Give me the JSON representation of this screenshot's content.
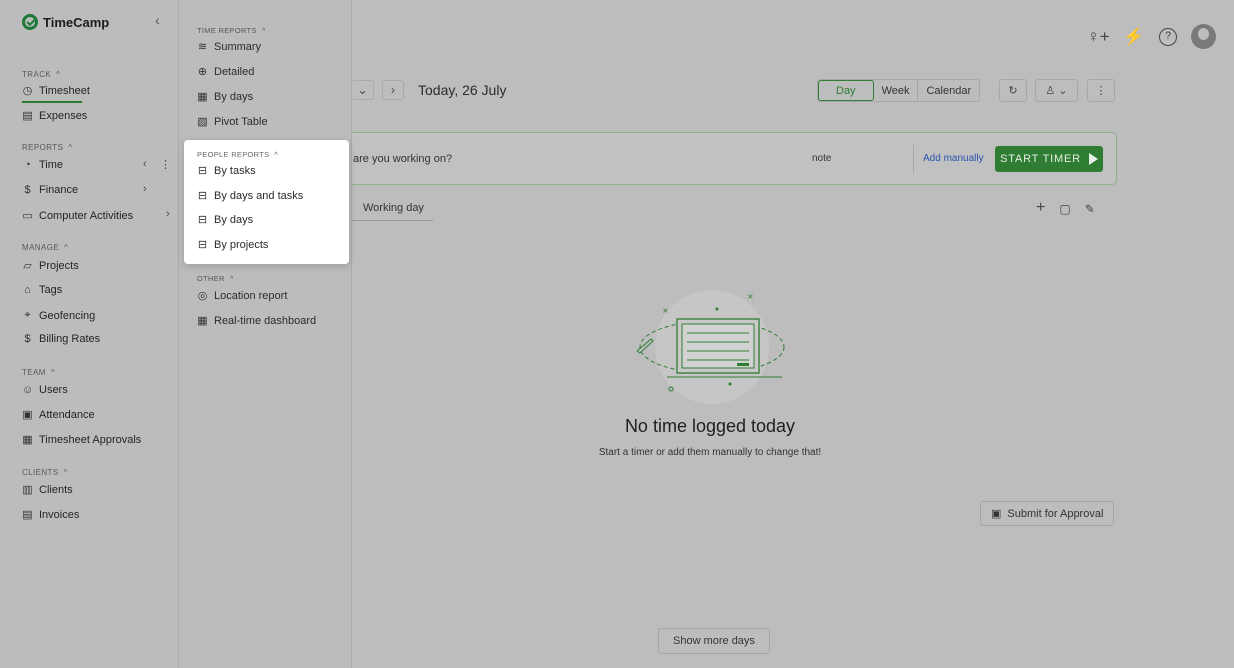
{
  "app": {
    "name": "TimeCamp",
    "collapse_glyph": "‹"
  },
  "sidebar": {
    "sections": [
      {
        "title": "TRACK",
        "items": [
          {
            "label": "Timesheet",
            "icon": "clock-icon",
            "glyph": "◷",
            "active": true
          },
          {
            "label": "Expenses",
            "icon": "receipt-icon",
            "glyph": "▤"
          }
        ]
      },
      {
        "title": "REPORTS",
        "items": [
          {
            "label": "Time",
            "icon": "pie-chart-icon",
            "glyph": "◔",
            "highlighted": true
          },
          {
            "label": "Finance",
            "icon": "dollar-icon",
            "glyph": "$"
          },
          {
            "label": "Computer Activities",
            "icon": "laptop-icon",
            "glyph": "▭"
          }
        ]
      },
      {
        "title": "MANAGE",
        "items": [
          {
            "label": "Projects",
            "icon": "folder-icon",
            "glyph": "▱"
          },
          {
            "label": "Tags",
            "icon": "tag-icon",
            "glyph": "⌂"
          },
          {
            "label": "Geofencing",
            "icon": "geofence-icon",
            "glyph": "⌖"
          },
          {
            "label": "Billing Rates",
            "icon": "dollar-icon",
            "glyph": "$"
          }
        ]
      },
      {
        "title": "TEAM",
        "items": [
          {
            "label": "Users",
            "icon": "users-icon",
            "glyph": "☺"
          },
          {
            "label": "Attendance",
            "icon": "attendance-icon",
            "glyph": "▣"
          },
          {
            "label": "Timesheet Approvals",
            "icon": "calendar-check-icon",
            "glyph": "▦"
          }
        ]
      },
      {
        "title": "CLIENTS",
        "items": [
          {
            "label": "Clients",
            "icon": "briefcase-icon",
            "glyph": "▥"
          },
          {
            "label": "Invoices",
            "icon": "invoice-icon",
            "glyph": "▤"
          }
        ]
      }
    ]
  },
  "reports_menu": {
    "time_reports": {
      "title": "TIME REPORTS",
      "items": [
        {
          "label": "Summary",
          "icon": "summary-icon",
          "glyph": "≋"
        },
        {
          "label": "Detailed",
          "icon": "magnify-icon",
          "glyph": "⊕"
        },
        {
          "label": "By days",
          "icon": "calendar-icon",
          "glyph": "▦"
        },
        {
          "label": "Pivot Table",
          "icon": "pivot-icon",
          "glyph": "▧"
        }
      ]
    },
    "people_reports": {
      "title": "PEOPLE REPORTS",
      "items": [
        {
          "label": "By tasks",
          "icon": "people-report-icon",
          "glyph": "⊟"
        },
        {
          "label": "By days and tasks",
          "icon": "people-report-icon",
          "glyph": "⊟"
        },
        {
          "label": "By days",
          "icon": "people-report-icon",
          "glyph": "⊟"
        },
        {
          "label": "By projects",
          "icon": "people-report-icon",
          "glyph": "⊟"
        }
      ]
    },
    "other": {
      "title": "OTHER",
      "items": [
        {
          "label": "Location report",
          "icon": "location-icon",
          "glyph": "◎"
        },
        {
          "label": "Real-time dashboard",
          "icon": "dashboard-icon",
          "glyph": "▦"
        }
      ]
    }
  },
  "header": {
    "icons": [
      {
        "name": "add-user-icon",
        "glyph": "♀+"
      },
      {
        "name": "plug-icon",
        "glyph": "⚡"
      },
      {
        "name": "help-icon",
        "glyph": "?"
      }
    ]
  },
  "timesheet": {
    "date_label": "Today, 26 July",
    "prev_glyph": "⌄",
    "next_glyph": "›",
    "views": [
      "Day",
      "Week",
      "Calendar"
    ],
    "active_view": "Day",
    "refresh_glyph": "↻",
    "user_glyph": "♙ ⌄",
    "more_glyph": "⋮",
    "task_prompt": "are you working on?",
    "note_label": "note",
    "add_manually_label": "Add manually",
    "start_timer_label": "START TIMER",
    "working_day_label": "Working day",
    "action_icons": [
      {
        "name": "add-entry-icon",
        "glyph": "+"
      },
      {
        "name": "copy-icon",
        "glyph": "▢"
      },
      {
        "name": "edit-icon",
        "glyph": "✎"
      }
    ],
    "empty_title": "No time logged today",
    "empty_subtitle": "Start a timer or add them manually to change that!",
    "submit_label": "Submit for Approval",
    "submit_glyph": "▣",
    "show_more_label": "Show more days"
  },
  "colors": {
    "brand_green": "#2e7d32",
    "link_blue": "#2b52b3",
    "overlay_gray": "#bdbdbd"
  }
}
